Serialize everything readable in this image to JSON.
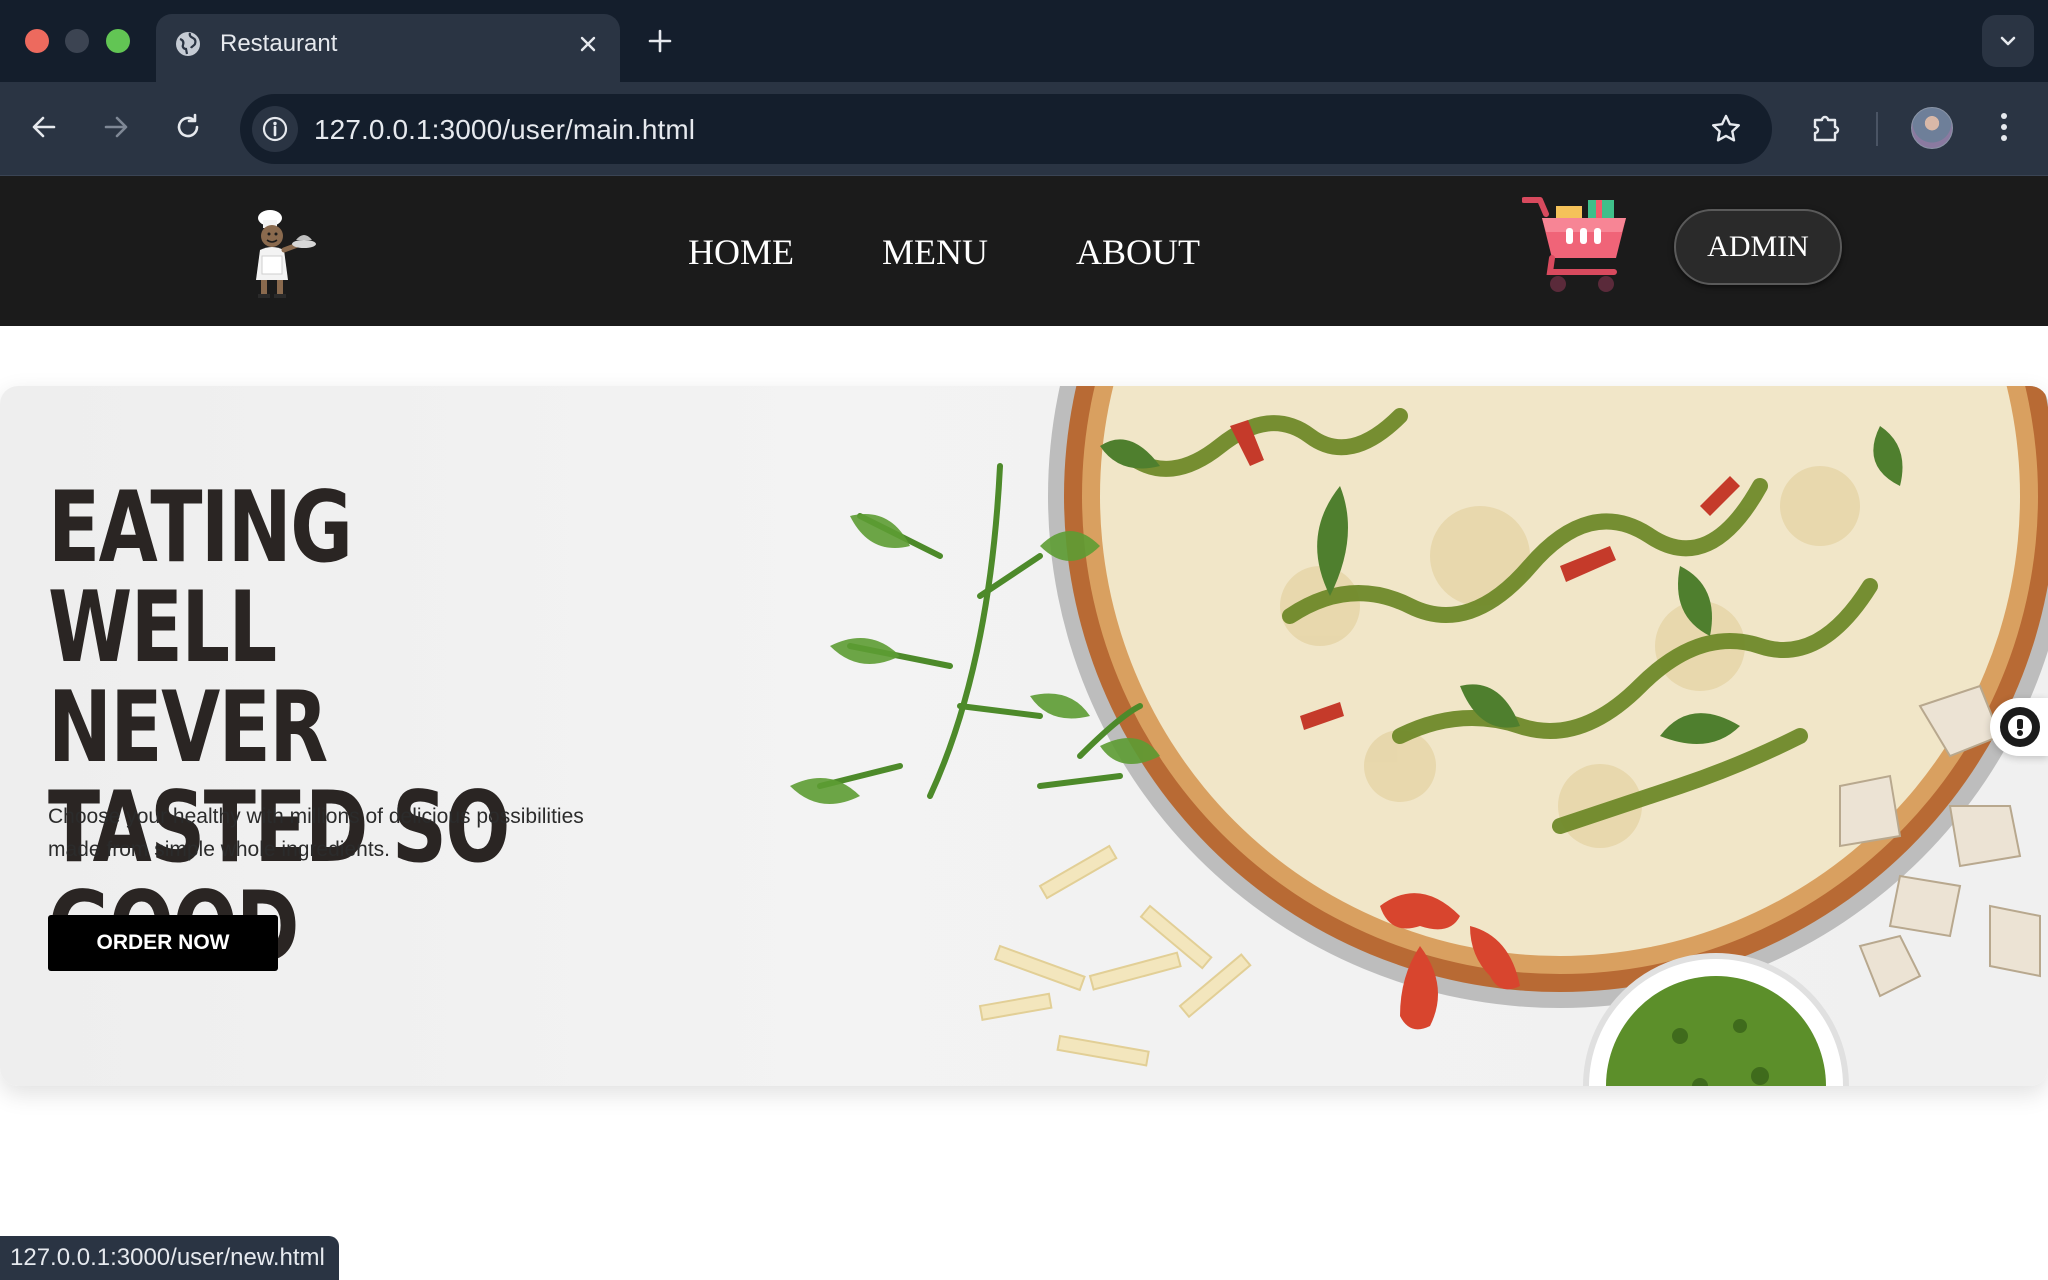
{
  "browser": {
    "tab": {
      "title": "Restaurant"
    },
    "address": {
      "url": "127.0.0.1:3000/user/main.html"
    },
    "status_url": "127.0.0.1:3000/user/new.html"
  },
  "navbar": {
    "links": [
      "HOME",
      "MENU",
      "ABOUT"
    ],
    "admin_label": "ADMIN"
  },
  "hero": {
    "title": "EATING WELL\nNEVER TASTED SO\nGOOD",
    "description": "Choose your healthy with millions of delicious possibilities made from simple whole ingredients.",
    "cta_label": "ORDER NOW"
  }
}
